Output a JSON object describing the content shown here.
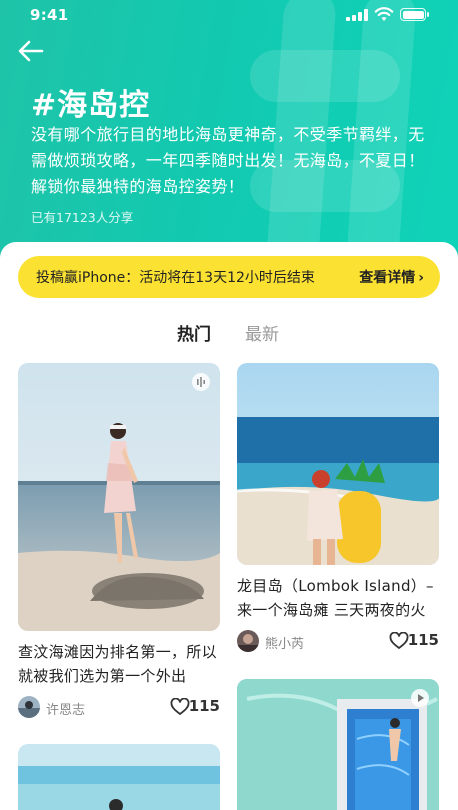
{
  "status_bar": {
    "time": "9:41"
  },
  "topic": {
    "title": "#海岛控",
    "description": "没有哪个旅行目的地比海岛更神奇，不受季节羁绊，无需做烦琐攻略，一年四季随时出发！无海岛，不夏日！解锁你最独特的海岛控姿势！",
    "share_count": "已有17123人分享"
  },
  "promo": {
    "text": "投稿赢iPhone：活动将在13天12小时后结束",
    "link": "查看详情"
  },
  "tabs": [
    {
      "label": "热门",
      "active": true
    },
    {
      "label": "最新",
      "active": false
    }
  ],
  "posts": [
    {
      "title": "查汶海滩因为排名第一，所以就被我们选为第一个外出",
      "author": "许恩志",
      "likes": "115",
      "icon": "audio-badge-icon"
    },
    {
      "title": "龙目岛（Lombok Island）– 来一个海岛瘫 三天两夜的火",
      "author": "熊小芮",
      "likes": "115",
      "icon": "none"
    },
    {
      "title": "",
      "author": "",
      "likes": "",
      "icon": "video-badge-icon"
    },
    {
      "title": "",
      "author": "",
      "likes": "",
      "icon": "none"
    }
  ],
  "colors": {
    "header": "#1fc4a8",
    "promo": "#fbe232",
    "text": "#222222",
    "muted": "#999999"
  }
}
